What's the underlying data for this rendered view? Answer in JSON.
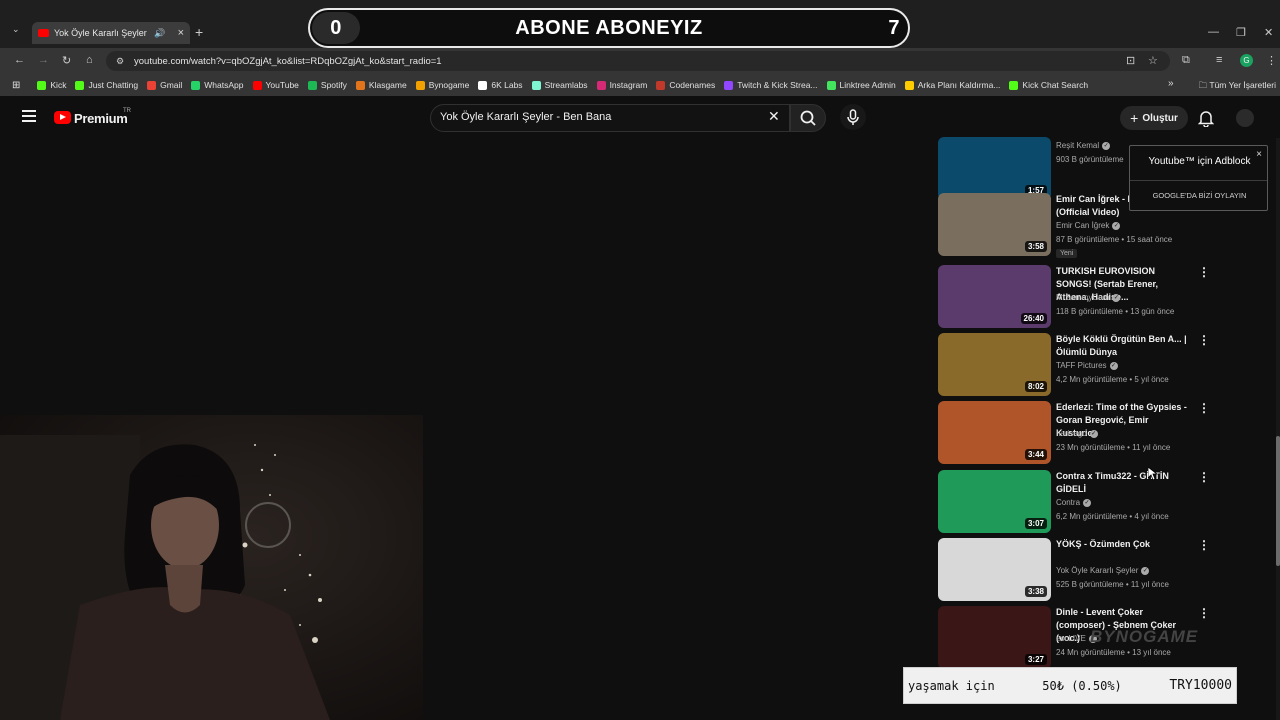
{
  "browser": {
    "tab_title": "Yok Öyle Kararlı Şeyler - Be",
    "url": "youtube.com/watch?v=qbOZgjAt_ko&list=RDqbOZgjAt_ko&start_radio=1",
    "bookmarks": [
      {
        "label": "Kick",
        "color": "#53fc18"
      },
      {
        "label": "Just Chatting",
        "color": "#53fc18"
      },
      {
        "label": "Gmail",
        "color": "#ea4335"
      },
      {
        "label": "WhatsApp",
        "color": "#25d366"
      },
      {
        "label": "YouTube",
        "color": "#ff0000"
      },
      {
        "label": "Spotify",
        "color": "#1db954"
      },
      {
        "label": "Klasgame",
        "color": "#e2751c"
      },
      {
        "label": "Bynogame",
        "color": "#f2a200"
      },
      {
        "label": "6K Labs",
        "color": "#ffffff"
      },
      {
        "label": "Streamlabs",
        "color": "#80f5d2"
      },
      {
        "label": "Instagram",
        "color": "#d62976"
      },
      {
        "label": "Codenames",
        "color": "#c0392b"
      },
      {
        "label": "Twitch & Kick Strea...",
        "color": "#9146ff"
      },
      {
        "label": "Linktree Admin",
        "color": "#43e55e"
      },
      {
        "label": "Arka Planı Kaldırma...",
        "color": "#ffcc00"
      },
      {
        "label": "Kick Chat Search",
        "color": "#53fc18"
      }
    ],
    "all_bookmarks_label": "Tüm Yer İşaretleri"
  },
  "overlay": {
    "title": "ABONE ABONEYIZ",
    "left_count": "0",
    "right_count": "7"
  },
  "youtube": {
    "logo_text": "Premium",
    "region": "TR",
    "search_value": "Yok Öyle Kararlı Şeyler - Ben Bana",
    "create_label": "Oluştur"
  },
  "adblock": {
    "title": "Youtube™ için Adblock",
    "button": "GOOGLE'DA BİZİ OYLAYIN",
    "close": "×"
  },
  "videos": [
    {
      "title": "",
      "channel": "Reşit Kemal",
      "meta": "903 B görüntüleme",
      "duration": "1:57",
      "thumb": "#0b4a6b",
      "badge": ""
    },
    {
      "title": "Emir Can İğrek - Boyalı Saçlar (Official Video)",
      "channel": "Emir Can İğrek",
      "meta": "87 B görüntüleme • 15 saat önce",
      "duration": "3:58",
      "thumb": "#7a6e5e",
      "badge": "Yeni"
    },
    {
      "title": "TURKISH EUROVISION SONGS! (Sertab Erener, Athena, Hadise...",
      "channel": "MrSammyCam",
      "meta": "118 B görüntüleme • 13 gün önce",
      "duration": "26:40",
      "thumb": "#5b3b6b",
      "badge": ""
    },
    {
      "title": "Böyle Köklü Örgütün Ben A... | Ölümlü Dünya",
      "channel": "TAFF Pictures",
      "meta": "4,2 Mn görüntüleme • 5 yıl önce",
      "duration": "8:02",
      "thumb": "#8a6a2a",
      "badge": ""
    },
    {
      "title": "Ederlezi: Time of the Gypsies - Goran Bregović, Emir Kusturica",
      "channel": "harisego",
      "meta": "23 Mn görüntüleme • 11 yıl önce",
      "duration": "3:44",
      "thumb": "#b0552a",
      "badge": ""
    },
    {
      "title": "Contra x Timu322 - GİTTİN GİDELİ",
      "channel": "Contra",
      "meta": "6,2 Mn görüntüleme • 4 yıl önce",
      "duration": "3:07",
      "thumb": "#1f9a58",
      "badge": ""
    },
    {
      "title": "YÖKŞ - Özümden Çok",
      "channel": "Yok Öyle Kararlı Şeyler",
      "meta": "525 B görüntüleme • 11 yıl önce",
      "duration": "3:38",
      "thumb": "#d8d8d8",
      "badge": ""
    },
    {
      "title": "Dinle - Levent Çoker (composer) - Şebnem Çoker (voc.)",
      "channel": "escLIVE",
      "meta": "24 Mn görüntüleme • 13 yıl önce",
      "duration": "3:27",
      "thumb": "#3a1616",
      "badge": ""
    }
  ],
  "donation": {
    "label": "yaşamak için",
    "amount": "50₺ (0.50%)",
    "goal": "TRY10000"
  },
  "watermark": "BYNOGAME"
}
